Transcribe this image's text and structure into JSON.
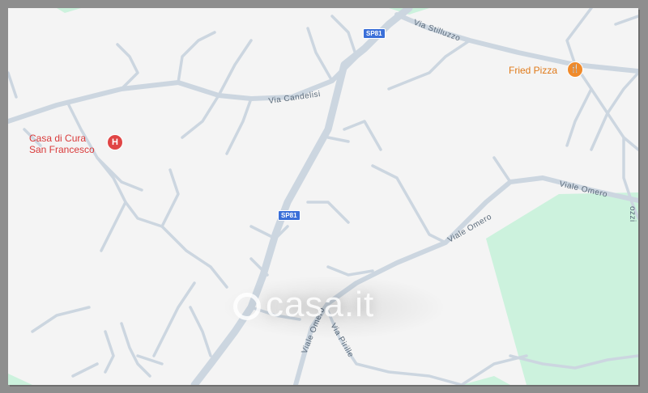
{
  "map": {
    "colors": {
      "background": "#f4f4f4",
      "road": "#ccd6e0",
      "park": "#ccf2dd",
      "highway_shield": "#3a6fd8",
      "hospital": "#e04545",
      "restaurant": "#f08a2a"
    },
    "streets": {
      "via_stilluzzo": "Via Stilluzzo",
      "via_candelisi": "Via Candelisi",
      "viale_omero_east": "Viale Omero",
      "viale_omero_mid": "Viale Omero",
      "viale_omero_south": "Viale Omero",
      "via_pirille": "Via Pirille",
      "edge_label": "ozzi"
    },
    "shields": {
      "sp81_top": "SP81",
      "sp81_mid": "SP81"
    },
    "pois": {
      "hospital": {
        "name_line1": "Casa di Cura",
        "name_line2": "San Francesco",
        "icon": "hospital-icon",
        "glyph": "H"
      },
      "restaurant": {
        "name": "Fried Pizza",
        "icon": "restaurant-icon",
        "glyph": "🍴"
      }
    },
    "watermark": "casa.it"
  }
}
